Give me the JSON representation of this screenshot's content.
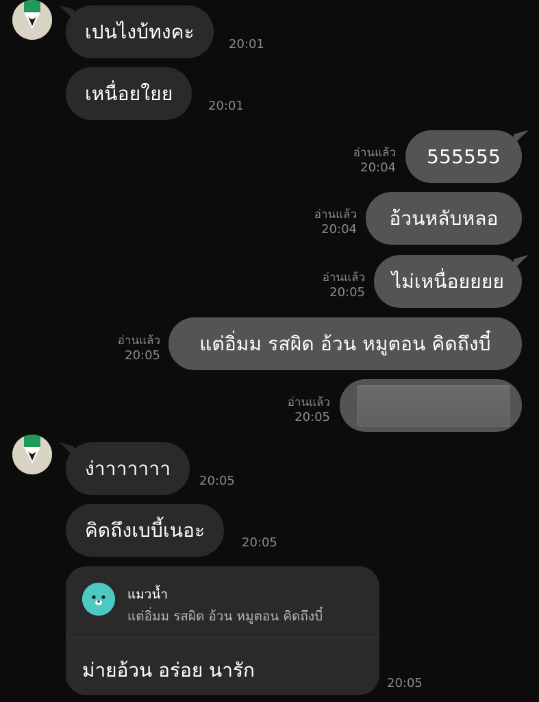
{
  "colors": {
    "background": "#0c0c0c",
    "incoming_bubble": "#2a2a2a",
    "outgoing_bubble": "#545454",
    "timestamp": "#8a8a8a",
    "reply_avatar": "#4cc9c3",
    "avatar_bg": "#d9d4c3",
    "avatar_green": "#1f9a5a"
  },
  "messages": [
    {
      "text": "เปนไงบ้ทงคะ",
      "time": "20:01"
    },
    {
      "text": "เหนื่อยใยย",
      "time": "20:01"
    },
    {
      "text": "555555",
      "read": "อ่านแล้ว",
      "time": "20:04"
    },
    {
      "text": "อ้วนหลับหลอ",
      "read": "อ่านแล้ว",
      "time": "20:04"
    },
    {
      "text": "ไม่เหนื่อยยยย",
      "read": "อ่านแล้ว",
      "time": "20:05"
    },
    {
      "text": "แต่อิ่มม รสผิด อ้วน หมูตอน คิดถึงบี๋",
      "read": "อ่านแล้ว",
      "time": "20:05"
    },
    {
      "image": "photo-thumbnail",
      "read": "อ่านแล้ว",
      "time": "20:05"
    },
    {
      "text": "ง่าาาาาาา",
      "time": "20:05"
    },
    {
      "text": "คิดถึงเบบี้เนอะ",
      "time": "20:05"
    },
    {
      "reply": {
        "quoted_name": "แมวน้ำ",
        "quoted_text": "แต่อิ่มม รสผิด อ้วน หมูตอน คิดถึงบี๋",
        "text": "ม่ายอ้วน อร่อย นารัก"
      },
      "time": "20:05"
    }
  ]
}
